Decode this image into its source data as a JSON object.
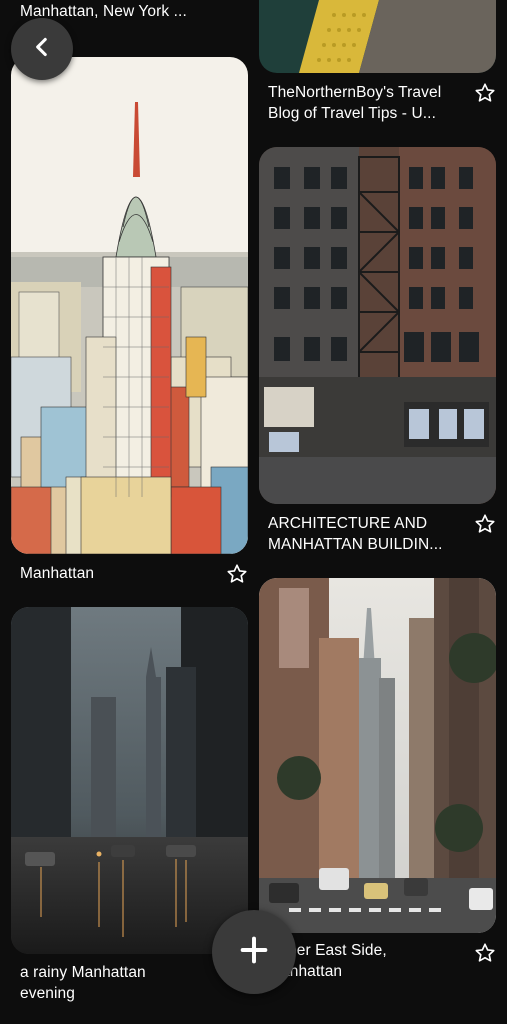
{
  "back_button": {
    "icon": "chevron-left-icon",
    "label": "Back"
  },
  "add_button": {
    "icon": "plus-icon",
    "label": "Add"
  },
  "pins": [
    {
      "title": "Upper East Side, Manhattan, New York ...",
      "saved": false
    },
    {
      "title": "TheNorthernBoy's Travel Blog of Travel Tips - U...",
      "saved": false
    },
    {
      "title": "Manhattan",
      "saved": false
    },
    {
      "title": "ARCHITECTURE AND MANHATTAN BUILDIN...",
      "saved": false
    },
    {
      "title": "a rainy Manhattan evening",
      "saved": false
    },
    {
      "title": "Upper East Side, Manhattan",
      "saved": false
    }
  ]
}
